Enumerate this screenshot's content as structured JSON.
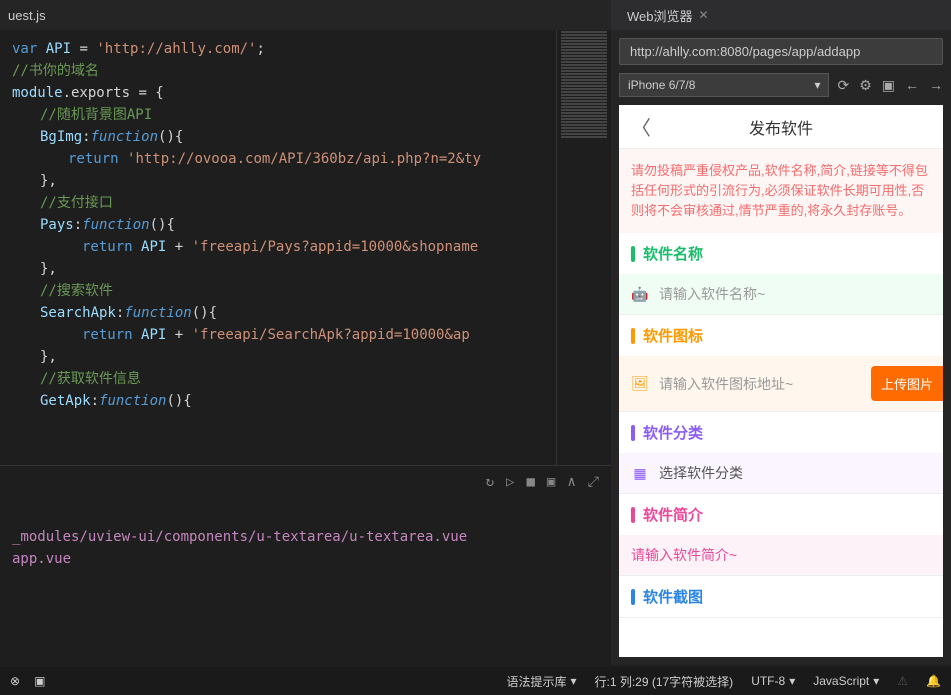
{
  "editor": {
    "tab": "uest.js",
    "code": {
      "l1_var": "var",
      "l1_api": "API",
      "l1_eq": "=",
      "l1_str": "'http://ahlly.com/'",
      "l1_semi": ";",
      "l2_com": "//书你的域名",
      "l3_mod": "module",
      "l3_exp": ".exports",
      "l3_eq": " = {",
      "l4_com": "//随机背景图API",
      "l5_name": "BgImg",
      "l5_fn": "function",
      "l5_paren": "(){",
      "l6_ret": "return",
      "l6_str": "'http://ovooa.com/API/360bz/api.php?n=2&ty",
      "l7_brace": "},",
      "l8_com": "//支付接口",
      "l9_name": "Pays",
      "l9_fn": "function",
      "l9_paren": "(){",
      "l10_ret": "return",
      "l10_api": "API",
      "l10_plus": "+",
      "l10_str": "'freeapi/Pays?appid=10000&shopname",
      "l11_brace": "},",
      "l12_com": "//搜索软件",
      "l13_name": "SearchApk",
      "l13_fn": "function",
      "l13_paren": "(){",
      "l14_ret": "return",
      "l14_api": "API",
      "l14_plus": "+",
      "l14_str": "'freeapi/SearchApk?appid=10000&ap",
      "l15_brace": "},",
      "l16_com": "//获取软件信息",
      "l17_name": "GetApk",
      "l17_fn": "function",
      "l17_paren": "(){"
    },
    "terminal": {
      "path1": "_modules/uview-ui/components/u-textarea/u-textarea.vue",
      "path2": "app.vue"
    }
  },
  "browser": {
    "tab_title": "Web浏览器",
    "url": "http://ahlly.com:8080/pages/app/addapp",
    "device": "iPhone 6/7/8"
  },
  "mobile": {
    "title": "发布软件",
    "warning": "请勿投稿严重侵权产品,软件名称,简介,链接等不得包括任何形式的引流行为,必须保证软件长期可用性,否则将不会审核通过,情节严重的,将永久封存账号。",
    "sections": {
      "name": {
        "title": "软件名称",
        "placeholder": "请输入软件名称~"
      },
      "icon": {
        "title": "软件图标",
        "placeholder": "请输入软件图标地址~",
        "btn": "上传图片"
      },
      "category": {
        "title": "软件分类",
        "placeholder": "选择软件分类"
      },
      "desc": {
        "title": "软件简介",
        "placeholder": "请输入软件简介~"
      },
      "screenshot": {
        "title": "软件截图"
      }
    }
  },
  "statusbar": {
    "grammar": "语法提示库",
    "position": "行:1 列:29 (17字符被选择)",
    "encoding": "UTF-8",
    "lang": "JavaScript"
  }
}
